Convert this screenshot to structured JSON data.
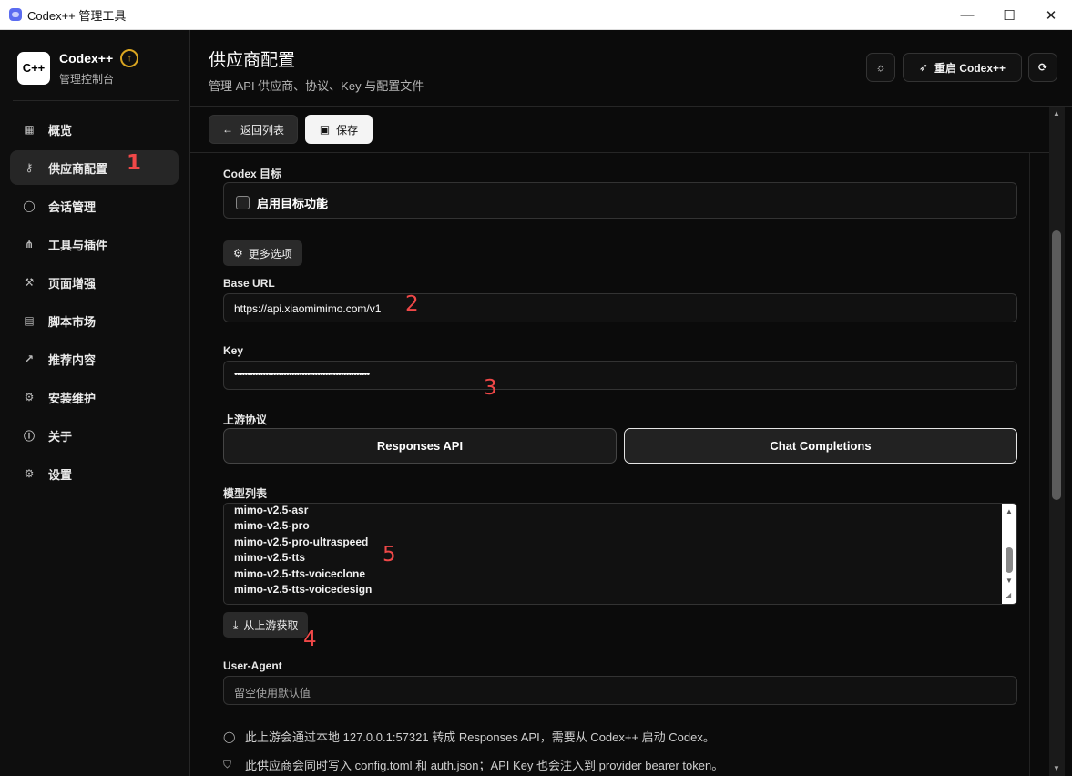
{
  "window": {
    "title": "Codex++ 管理工具",
    "controls": {
      "minimize": "—",
      "maximize": "☐",
      "close": "✕"
    }
  },
  "sidebar": {
    "logo_text": "C++",
    "brand_name": "Codex++",
    "brand_sub": "管理控制台",
    "items": [
      {
        "label": "概览",
        "icon": "grid-icon",
        "glyph": "▦"
      },
      {
        "label": "供应商配置",
        "icon": "key-icon",
        "glyph": "⚷"
      },
      {
        "label": "会话管理",
        "icon": "chat-icon",
        "glyph": "◯"
      },
      {
        "label": "工具与插件",
        "icon": "network-icon",
        "glyph": "⋔"
      },
      {
        "label": "页面增强",
        "icon": "hammer-icon",
        "glyph": "⚒"
      },
      {
        "label": "脚本市场",
        "icon": "file-code-icon",
        "glyph": "▤"
      },
      {
        "label": "推荐内容",
        "icon": "external-link-icon",
        "glyph": "↗"
      },
      {
        "label": "安装维护",
        "icon": "wrench-icon",
        "glyph": "⚙"
      },
      {
        "label": "关于",
        "icon": "info-icon",
        "glyph": "ⓘ"
      },
      {
        "label": "设置",
        "icon": "gear-icon",
        "glyph": "⚙"
      }
    ]
  },
  "header": {
    "title": "供应商配置",
    "subtitle": "管理 API 供应商、协议、Key 与配置文件",
    "restart_label": "重启 Codex++"
  },
  "toolbar": {
    "back_label": "返回列表",
    "save_label": "保存"
  },
  "form": {
    "codex_target_label": "Codex 目标",
    "enable_target_label": "启用目标功能",
    "more_options_label": "更多选项",
    "base_url_label": "Base URL",
    "base_url_value": "https://api.xiaomimimo.com/v1",
    "key_label": "Key",
    "key_value": "••••••••••••••••••••••••••••••••••••••••••••••••••••",
    "protocol_label": "上游协议",
    "protocol_options": [
      "Responses API",
      "Chat Completions"
    ],
    "protocol_selected": "Chat Completions",
    "models_label": "模型列表",
    "models": [
      "mimo-v2.5-asr",
      "mimo-v2.5-pro",
      "mimo-v2.5-pro-ultraspeed",
      "mimo-v2.5-tts",
      "mimo-v2.5-tts-voiceclone",
      "mimo-v2.5-tts-voicedesign"
    ],
    "fetch_label": "从上游获取",
    "user_agent_label": "User-Agent",
    "user_agent_placeholder": "留空使用默认值",
    "note_1": "此上游会通过本地 127.0.0.1:57321 转成 Responses API，需要从 Codex++ 启动 Codex。",
    "note_2": "此供应商会同时写入 config.toml 和 auth.json；API Key 也会注入到 provider bearer token。"
  },
  "annotations": [
    "1",
    "2",
    "3",
    "4",
    "5"
  ],
  "colors": {
    "accent_gold": "#d9a520",
    "annotation_red": "#f04848"
  }
}
